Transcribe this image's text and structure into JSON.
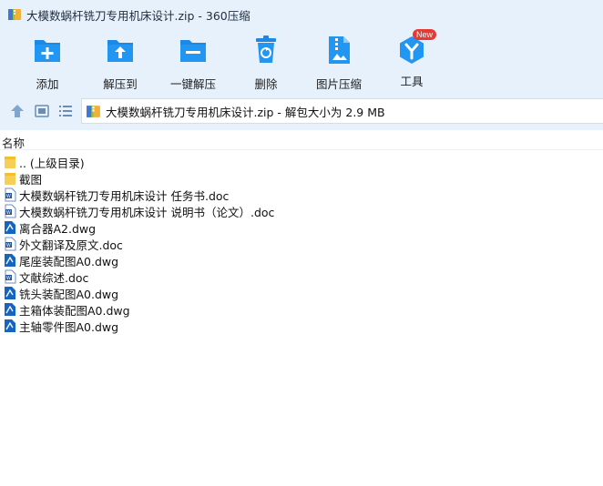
{
  "window": {
    "title": "大模数蜗杆铣刀专用机床设计.zip - 360压缩"
  },
  "toolbar": {
    "items": [
      {
        "label": "添加",
        "icon": "add-icon"
      },
      {
        "label": "解压到",
        "icon": "extract-to-icon"
      },
      {
        "label": "一键解压",
        "icon": "one-click-extract-icon"
      },
      {
        "label": "删除",
        "icon": "delete-icon"
      },
      {
        "label": "图片压缩",
        "icon": "image-compress-icon"
      },
      {
        "label": "工具",
        "icon": "tools-icon",
        "badge": "New"
      }
    ]
  },
  "address": {
    "path": "大模数蜗杆铣刀专用机床设计.zip - 解包大小为 2.9 MB"
  },
  "list": {
    "header": "名称",
    "items": [
      {
        "name": ".. (上级目录)",
        "type": "folder"
      },
      {
        "name": "截图",
        "type": "folder"
      },
      {
        "name": "大模数蜗杆铣刀专用机床设计 任务书.doc",
        "type": "doc"
      },
      {
        "name": "大模数蜗杆铣刀专用机床设计 说明书（论文）.doc",
        "type": "doc"
      },
      {
        "name": "离合器A2.dwg",
        "type": "dwg"
      },
      {
        "name": "外文翻译及原文.doc",
        "type": "doc"
      },
      {
        "name": "尾座装配图A0.dwg",
        "type": "dwg"
      },
      {
        "name": "文献综述.doc",
        "type": "doc"
      },
      {
        "name": "铣头装配图A0.dwg",
        "type": "dwg"
      },
      {
        "name": "主箱体装配图A0.dwg",
        "type": "dwg"
      },
      {
        "name": "主轴零件图A0.dwg",
        "type": "dwg"
      }
    ]
  },
  "colors": {
    "accent": "#1e88e5",
    "toolbar_bg": "#e6f1fc",
    "badge": "#e53935"
  }
}
